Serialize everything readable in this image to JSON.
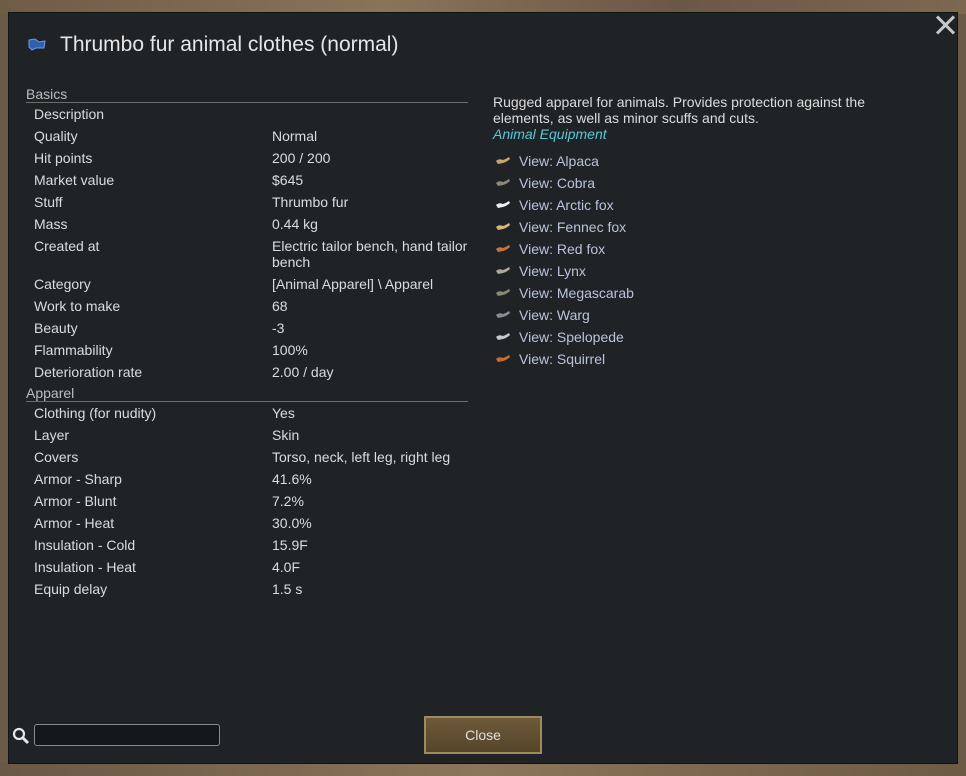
{
  "window": {
    "title": "Thrumbo fur animal clothes (normal)",
    "close_label": "Close",
    "search_placeholder": ""
  },
  "basics": {
    "header": "Basics",
    "rows": [
      {
        "label": "Description",
        "value": ""
      },
      {
        "label": "Quality",
        "value": "Normal"
      },
      {
        "label": "Hit points",
        "value": "200 / 200"
      },
      {
        "label": "Market value",
        "value": "$645"
      },
      {
        "label": "Stuff",
        "value": "Thrumbo fur"
      },
      {
        "label": "Mass",
        "value": "0.44 kg"
      },
      {
        "label": "Created at",
        "value": "Electric tailor bench, hand tailor bench"
      },
      {
        "label": "Category",
        "value": "[Animal Apparel] \\ Apparel"
      },
      {
        "label": "Work to make",
        "value": "68"
      },
      {
        "label": "Beauty",
        "value": "-3"
      },
      {
        "label": "Flammability",
        "value": "100%"
      },
      {
        "label": "Deterioration rate",
        "value": "2.00 / day"
      }
    ]
  },
  "apparel": {
    "header": "Apparel",
    "rows": [
      {
        "label": "Clothing (for nudity)",
        "value": "Yes"
      },
      {
        "label": "Layer",
        "value": "Skin"
      },
      {
        "label": "Covers",
        "value": "Torso, neck, left leg, right leg"
      },
      {
        "label": "Armor - Sharp",
        "value": "41.6%"
      },
      {
        "label": "Armor - Blunt",
        "value": "7.2%"
      },
      {
        "label": "Armor - Heat",
        "value": "30.0%"
      },
      {
        "label": "Insulation - Cold",
        "value": "15.9F"
      },
      {
        "label": "Insulation - Heat",
        "value": "4.0F"
      },
      {
        "label": "Equip delay",
        "value": "1.5 s"
      }
    ]
  },
  "info": {
    "description": "Rugged apparel for animals. Provides protection against the elements, as well as minor scuffs and cuts.",
    "category": "Animal Equipment",
    "links": [
      {
        "label": "View: Alpaca",
        "icon": "alpaca-icon",
        "color": "#c9a56a"
      },
      {
        "label": "View: Cobra",
        "icon": "cobra-icon",
        "color": "#8b8a74"
      },
      {
        "label": "View: Arctic fox",
        "icon": "arctic-fox-icon",
        "color": "#eeeeee"
      },
      {
        "label": "View: Fennec fox",
        "icon": "fennec-fox-icon",
        "color": "#d9b77a"
      },
      {
        "label": "View: Red fox",
        "icon": "red-fox-icon",
        "color": "#c8743a"
      },
      {
        "label": "View: Lynx",
        "icon": "lynx-icon",
        "color": "#b0a898"
      },
      {
        "label": "View: Megascarab",
        "icon": "megascarab-icon",
        "color": "#8a8a70"
      },
      {
        "label": "View: Warg",
        "icon": "warg-icon",
        "color": "#8c8c8c"
      },
      {
        "label": "View: Spelopede",
        "icon": "spelopede-icon",
        "color": "#c8c8c8"
      },
      {
        "label": "View: Squirrel",
        "icon": "squirrel-icon",
        "color": "#d06a2a"
      }
    ]
  }
}
